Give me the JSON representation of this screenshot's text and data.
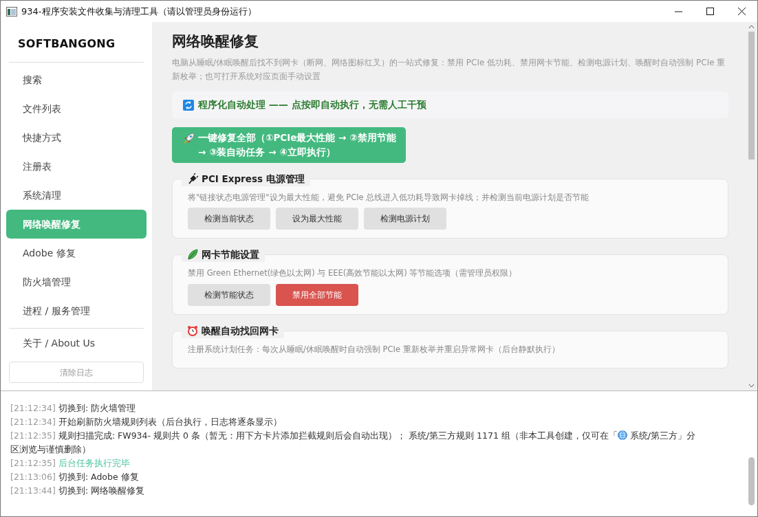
{
  "window": {
    "title": "934-程序安装文件收集与清理工具（请以管理员身份运行）"
  },
  "sidebar": {
    "logo": "SOFTBANGONG",
    "items": [
      {
        "label": "搜索",
        "selected": false
      },
      {
        "label": "文件列表",
        "selected": false
      },
      {
        "label": "快捷方式",
        "selected": false
      },
      {
        "label": "注册表",
        "selected": false
      },
      {
        "label": "系统清理",
        "selected": false
      },
      {
        "label": "网络唤醒修复",
        "selected": true
      },
      {
        "label": "Adobe 修复",
        "selected": false
      },
      {
        "label": "防火墙管理",
        "selected": false
      },
      {
        "label": "进程 / 服务管理",
        "selected": false
      }
    ],
    "footer_item": "关于 / About Us",
    "clear_button": "清除日志"
  },
  "page": {
    "title": "网络唤醒修复",
    "description": "电脑从睡眠/休眠唤醒后找不到网卡（断网、网络图标红叉）的一站式修复：禁用 PCIe 低功耗、禁用网卡节能、检测电源计划、唤醒时自动强制 PCIe 重新枚举；也可打开系统对应页面手动设置",
    "banner": "程序化自动处理 —— 点按即自动执行，无需人工干预",
    "fix_all_button": "一键修复全部（①PCIe最大性能 → ②禁用节能 → ③装自动任务 → ④立即执行）",
    "sections": [
      {
        "title": "PCI Express 电源管理",
        "description": "将\"链接状态电源管理\"设为最大性能，避免 PCIe 总线进入低功耗导致网卡掉线；并检测当前电源计划是否节能",
        "buttons": [
          {
            "label": "检测当前状态",
            "kind": "default"
          },
          {
            "label": "设为最大性能",
            "kind": "default"
          },
          {
            "label": "检测电源计划",
            "kind": "default"
          }
        ]
      },
      {
        "title": "网卡节能设置",
        "description": "禁用 Green Ethernet(绿色以太网) 与 EEE(高效节能以太网) 等节能选项（需管理员权限）",
        "buttons": [
          {
            "label": "检测节能状态",
            "kind": "default"
          },
          {
            "label": "禁用全部节能",
            "kind": "danger"
          }
        ]
      },
      {
        "title": "唤醒自动找回网卡",
        "description": "注册系统计划任务：每次从睡眠/休眠唤醒时自动强制 PCIe 重新枚举并重启异常网卡（后台静默执行）"
      }
    ]
  },
  "log": [
    {
      "time": "[21:12:34]",
      "message": "切换到: 防火墙管理",
      "kind": "info"
    },
    {
      "time": "[21:12:34]",
      "message": "开始刷新防火墙规则列表（后台执行，日志将逐条显示）",
      "kind": "info"
    },
    {
      "time": "[21:12:35]",
      "message": "规则扫描完成: FW934- 规则共 0 条（暂无：用下方卡片添加拦截规则后会自动出现）； 系统/第三方规则 1171 组（非本工具创建，仅可在「",
      "message_after": " 系统/第三方」分",
      "message_continued": "区浏览与谨慎删除）",
      "kind": "info"
    },
    {
      "time": "[21:12:35]",
      "message": "后台任务执行完毕",
      "kind": "success"
    },
    {
      "time": "[21:13:06]",
      "message": "切换到: Adobe 修复",
      "kind": "info"
    },
    {
      "time": "[21:13:44]",
      "message": "切换到: 网络唤醒修复",
      "kind": "info"
    }
  ]
}
